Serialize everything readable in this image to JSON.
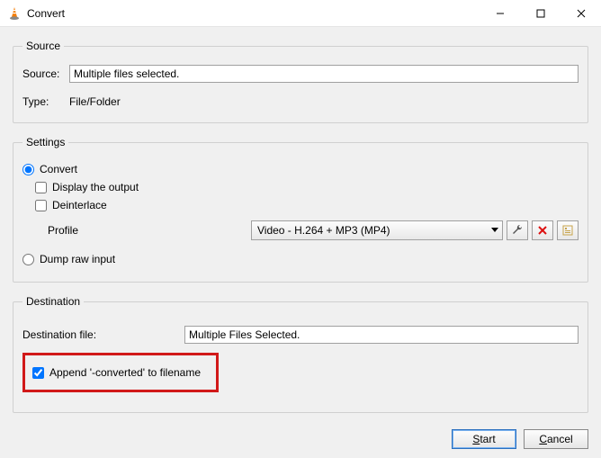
{
  "window": {
    "title": "Convert"
  },
  "source": {
    "legend": "Source",
    "source_label": "Source:",
    "source_value": "Multiple files selected.",
    "type_label": "Type:",
    "type_value": "File/Folder"
  },
  "settings": {
    "legend": "Settings",
    "convert_label": "Convert",
    "display_output_label": "Display the output",
    "deinterlace_label": "Deinterlace",
    "profile_label": "Profile",
    "profile_value": "Video - H.264 + MP3 (MP4)",
    "dump_label": "Dump raw input"
  },
  "destination": {
    "legend": "Destination",
    "dest_file_label": "Destination file:",
    "dest_file_value": "Multiple Files Selected.",
    "append_label": "Append '-converted' to filename"
  },
  "footer": {
    "start": "Start",
    "cancel": "Cancel"
  }
}
